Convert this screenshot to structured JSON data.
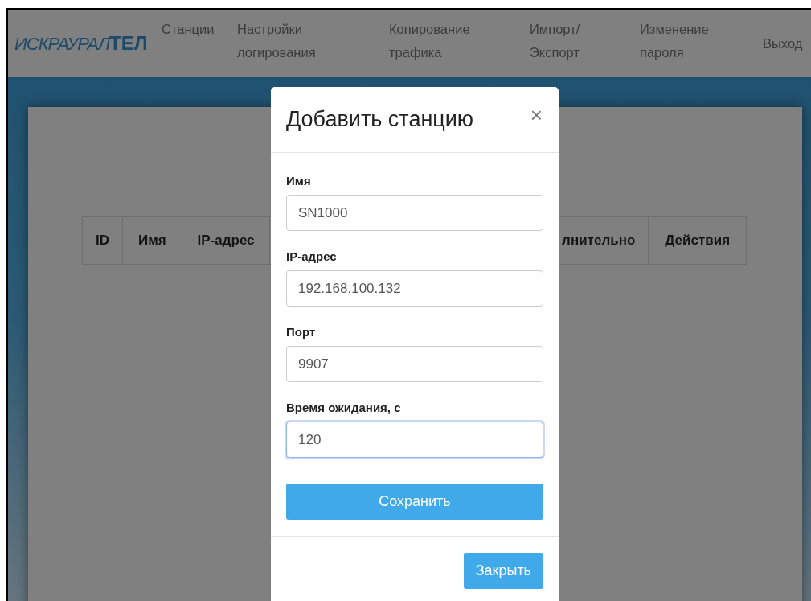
{
  "navbar": {
    "logo": "ИСКРАУРАЛ**ТЕЛ**",
    "items": [
      {
        "label": "Станции"
      },
      {
        "label": "Настройки логирования"
      },
      {
        "label": "Копирование трафика"
      },
      {
        "label": "Импорт/ Экспорт"
      },
      {
        "label": "Изменение пароля"
      },
      {
        "label": "Выход"
      }
    ]
  },
  "table": {
    "columns": [
      "ID",
      "Имя",
      "IP-адрес",
      "лнительно",
      "Действия"
    ]
  },
  "modal": {
    "title": "Добавить станцию",
    "close": "×",
    "fields": [
      {
        "label": "Имя",
        "value": "SN1000",
        "focused": false
      },
      {
        "label": "IP-адрес",
        "value": "192.168.100.132",
        "focused": false
      },
      {
        "label": "Порт",
        "value": "9907",
        "focused": false
      },
      {
        "label": "Время ожидания, с",
        "value": "120",
        "focused": true
      }
    ],
    "save_button": "Сохранить",
    "close_button": "Закрыть"
  }
}
